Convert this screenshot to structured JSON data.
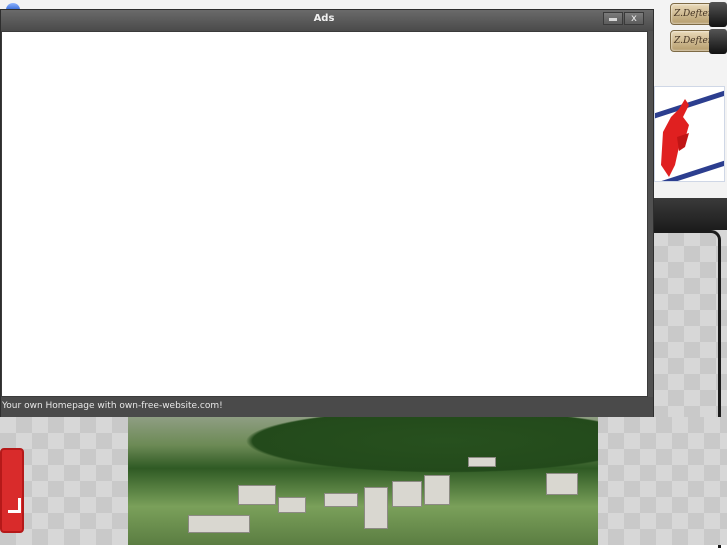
{
  "ads_window": {
    "title": "Ads",
    "footer_text": "Your own Homepage with own-free-website.com!",
    "close_label": "x"
  },
  "sidebar": {
    "badges": [
      {
        "label": "Z.Defteri"
      },
      {
        "label": "Z.Defteri"
      }
    ]
  }
}
